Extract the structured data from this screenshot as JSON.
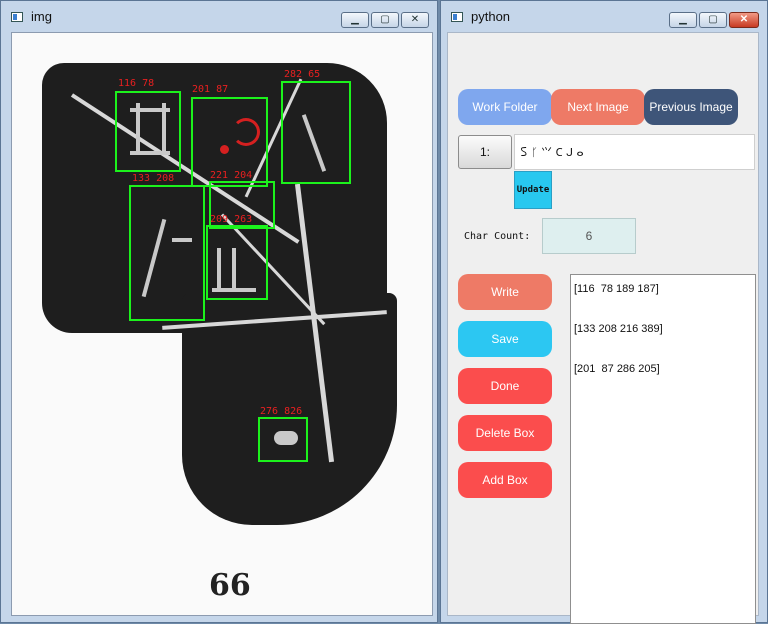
{
  "img_window": {
    "title": "img",
    "controls": {
      "minimize": "▁",
      "maximize": "▢",
      "close": "✕"
    },
    "plate_number": "66",
    "boxes": [
      {
        "label": "116 78"
      },
      {
        "label": "201 87"
      },
      {
        "label": "282 65"
      },
      {
        "label": "133 208"
      },
      {
        "label": "221 204"
      },
      {
        "label": "209 263"
      },
      {
        "label": "276 826"
      }
    ]
  },
  "py_window": {
    "title": "python",
    "controls": {
      "minimize": "▁",
      "maximize": "▢",
      "close": "✕"
    },
    "toolbar": {
      "work_folder": "Work Folder",
      "next_image": "Next Image",
      "previous_image": "Previous Image"
    },
    "index_label": "1:",
    "char_input_value": "𐊖 ᚴ ⺍ 𐊢 ᒍ ⴰ",
    "update_label": "Update",
    "char_count_label": "Char Count:",
    "char_count_value": "6",
    "actions": {
      "write": "Write",
      "save": "Save",
      "done": "Done",
      "delete_box": "Delete Box",
      "add_box": "Add Box"
    },
    "box_list": [
      "[116  78 189 187]",
      "[133 208 216 389]",
      "[201  87 286 205]"
    ]
  },
  "colors": {
    "bbox": "#1cf21c",
    "label": "#e82020",
    "work_folder": "#7fa7ee",
    "next_image": "#ee7a66",
    "previous_image": "#3e5579",
    "save": "#2cc7f2",
    "danger": "#fb4d4d"
  },
  "icons": [
    "window-app-icon",
    "minimize-icon",
    "maximize-icon",
    "close-icon"
  ]
}
